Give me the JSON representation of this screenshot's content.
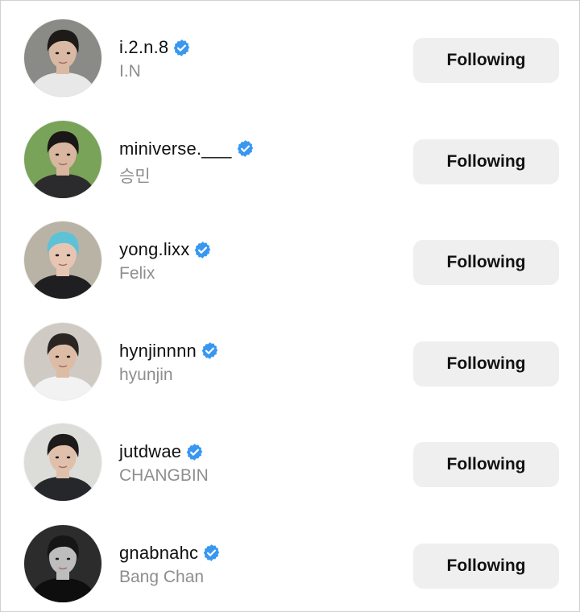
{
  "following_list": [
    {
      "username": "i.2.n.8",
      "full_name": "I.N",
      "verified": true,
      "button_label": "Following",
      "avatar": {
        "bg": "#8a8a86",
        "skin": "#d9b9a4",
        "hair": "#1e1a18",
        "cloth": "#e8e8e8"
      }
    },
    {
      "username": "miniverse.___",
      "full_name": "승민",
      "verified": true,
      "button_label": "Following",
      "avatar": {
        "bg": "#7aa35a",
        "skin": "#d8b6a0",
        "hair": "#1a1716",
        "cloth": "#2b2b2e"
      }
    },
    {
      "username": "yong.lixx",
      "full_name": "Felix",
      "verified": true,
      "button_label": "Following",
      "avatar": {
        "bg": "#b9b3a6",
        "skin": "#e6c6b2",
        "hair": "#5ec2d6",
        "cloth": "#1f1f21"
      }
    },
    {
      "username": "hynjinnnn",
      "full_name": "hyunjin",
      "verified": true,
      "button_label": "Following",
      "avatar": {
        "bg": "#cfcac4",
        "skin": "#ddbca6",
        "hair": "#2a2522",
        "cloth": "#f2f2f2"
      }
    },
    {
      "username": "jutdwae",
      "full_name": "CHANGBIN",
      "verified": true,
      "button_label": "Following",
      "avatar": {
        "bg": "#dcdcd8",
        "skin": "#e1c0ab",
        "hair": "#1c1a1a",
        "cloth": "#26272b"
      }
    },
    {
      "username": "gnabnahc",
      "full_name": "Bang Chan",
      "verified": true,
      "button_label": "Following",
      "avatar": {
        "bg": "#2c2c2c",
        "skin": "#bdbdbd",
        "hair": "#161616",
        "cloth": "#0e0e0e"
      }
    }
  ],
  "colors": {
    "verified_badge": "#3897f0",
    "button_bg": "#efefef",
    "secondary_text": "#8e8e8e"
  },
  "icons": {
    "verified": "verified-badge-icon",
    "avatar": "profile-photo"
  }
}
